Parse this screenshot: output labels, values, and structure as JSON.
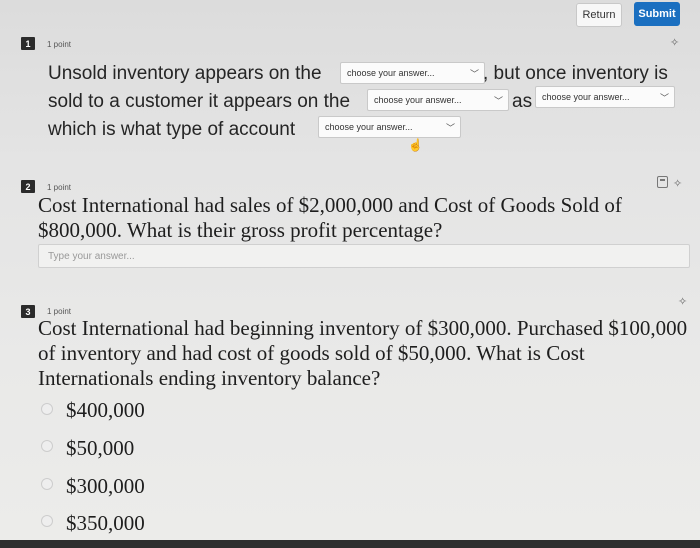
{
  "header": {
    "return_label": "Return",
    "submit_label": "Submit"
  },
  "q1": {
    "number": "1",
    "points": "1 point",
    "text_a": "Unsold inventory appears on the",
    "text_b": ", but once inventory is",
    "text_c": "sold to a customer it appears on the",
    "text_d": "as",
    "text_e": "which is what type of account",
    "dropdown_placeholder": "choose your answer..."
  },
  "q2": {
    "number": "2",
    "points": "1 point",
    "text": "Cost International had sales of $2,000,000 and Cost of Goods Sold of $800,000. What is their gross profit percentage?",
    "input_placeholder": "Type your answer..."
  },
  "q3": {
    "number": "3",
    "points": "1 point",
    "text": "Cost International had beginning inventory of $300,000. Purchased $100,000 of inventory and had cost of goods sold of $50,000. What is Cost Internationals ending inventory balance?",
    "options": [
      "$400,000",
      "$50,000",
      "$300,000",
      "$350,000"
    ]
  },
  "icons": {
    "pin": "pin-icon",
    "calculator": "calculator-icon",
    "chevron": "chevron-down-icon",
    "cursor": "hand-cursor-icon"
  }
}
